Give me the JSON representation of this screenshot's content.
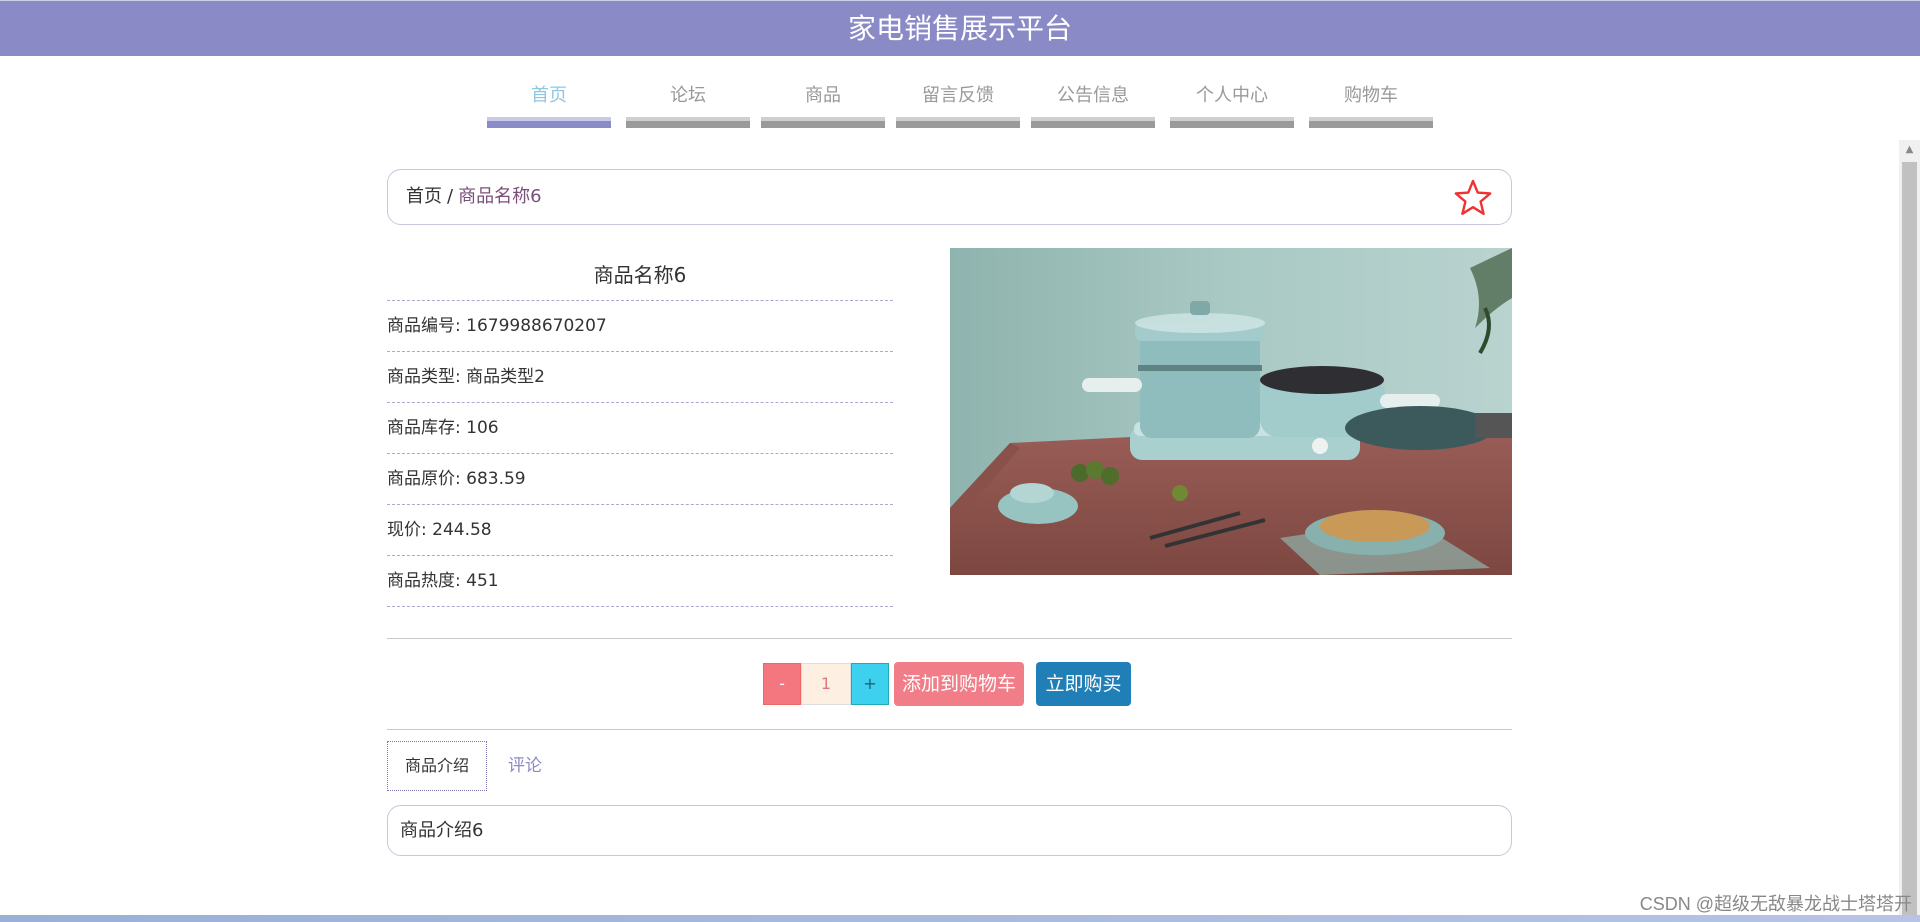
{
  "header": {
    "title": "家电销售展示平台"
  },
  "nav": {
    "items": [
      {
        "label": "首页"
      },
      {
        "label": "论坛"
      },
      {
        "label": "商品"
      },
      {
        "label": "留言反馈"
      },
      {
        "label": "公告信息"
      },
      {
        "label": "个人中心"
      },
      {
        "label": "购物车"
      }
    ],
    "active": "首页"
  },
  "breadcrumb": {
    "home": "首页",
    "separator": "/",
    "current": "商品名称6"
  },
  "product": {
    "name": "商品名称6",
    "rows": [
      "商品编号: 1679988670207",
      "商品类型: 商品类型2",
      "商品库存: 106",
      "商品原价: 683.59",
      "现价: 244.58",
      "商品热度: 451"
    ]
  },
  "purchase": {
    "minus_label": "-",
    "quantity": "1",
    "plus_label": "+",
    "add_to_cart_label": "添加到购物车",
    "buy_now_label": "立即购买"
  },
  "tabs": {
    "intro_label": "商品介绍",
    "review_label": "评论"
  },
  "intro": {
    "text": "商品介绍6"
  },
  "watermark": "CSDN @超级无敌暴龙战士塔塔开",
  "icons": {
    "favorite": "star-outline-icon",
    "scroll_up": "chevron-up-icon"
  },
  "colors": {
    "header_bg": "#8a8ac6",
    "nav_active_text": "#8fc8e0",
    "star": "#e33",
    "add_to_cart": "#f07d87",
    "buy_now": "#1f7fb6"
  }
}
